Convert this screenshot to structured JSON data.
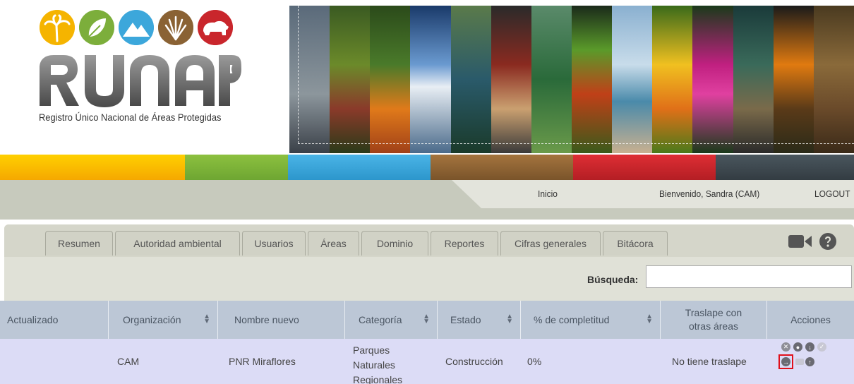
{
  "logo": {
    "word": "RUNAP",
    "subtitle": "Registro Único Nacional de Áreas Protegidas"
  },
  "colors": {
    "bars": [
      "#f7b500",
      "#7cae3b",
      "#3ca7db",
      "#8a6234",
      "#c9262c",
      "#3c474e"
    ],
    "topnav_bg": "#c7cabd",
    "table_header_bg": "#bcc7d6",
    "row_bg": "#dcdcf6",
    "highlight": "#e0101b"
  },
  "topnav": {
    "home": "Inicio",
    "welcome": "Bienvenido, Sandra (CAM)",
    "logout": "LOGOUT"
  },
  "tabs": [
    "Resumen",
    "Autoridad ambiental",
    "Usuarios",
    "Áreas",
    "Dominio",
    "Reportes",
    "Cifras generales",
    "Bitácora"
  ],
  "toolbar_icons": [
    "video-camera-icon",
    "help-icon"
  ],
  "search": {
    "label": "Búsqueda:",
    "value": ""
  },
  "table": {
    "columns": [
      "Actualizado",
      "Organización",
      "Nombre nuevo",
      "Categoría",
      "Estado",
      "% de completitud",
      "Traslape con otras áreas",
      "Acciones"
    ],
    "rows": [
      {
        "actualizado": "",
        "organizacion": "CAM",
        "nombre_nuevo": "PNR Miraflores",
        "categoria": "Parques Naturales Regionales",
        "estado": "Construcción",
        "completitud": "0%",
        "traslape": "No tiene traslape"
      }
    ]
  },
  "actions_icons": [
    "delete-icon",
    "comment-icon",
    "download-icon",
    "check-icon",
    "send-icon",
    "mail-icon",
    "upload-icon"
  ]
}
